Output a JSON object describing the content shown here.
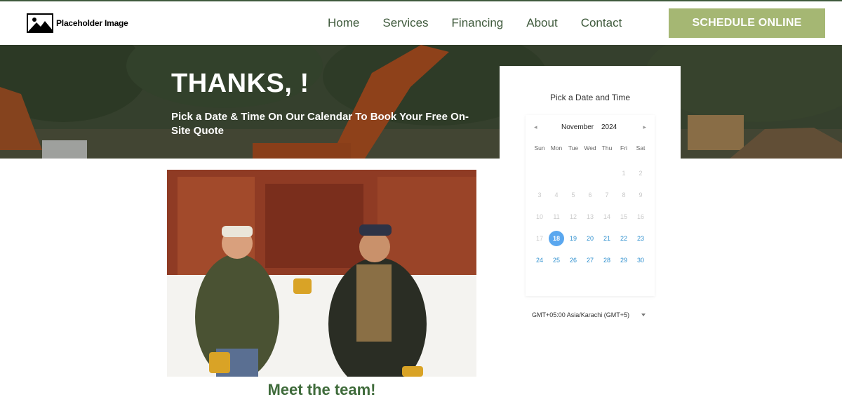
{
  "header": {
    "logo_text": "Placeholder Image",
    "nav": [
      "Home",
      "Services",
      "Financing",
      "About",
      "Contact"
    ],
    "cta_label": "SCHEDULE ONLINE"
  },
  "hero": {
    "title": "THANKS, !",
    "subtitle": "Pick a Date & Time On Our Calendar To Book Your Free On-Site Quote"
  },
  "booking": {
    "title": "Pick a Date and Time",
    "calendar": {
      "month": "November",
      "year": "2024",
      "weekdays": [
        "Sun",
        "Mon",
        "Tue",
        "Wed",
        "Thu",
        "Fri",
        "Sat"
      ],
      "prev_icon": "chevron-left-icon",
      "next_icon": "chevron-right-icon",
      "first_weekday_index": 5,
      "days_in_month": 30,
      "selected_day": 18,
      "first_available_day": 18
    },
    "timezone": "GMT+05:00 Asia/Karachi (GMT+5)"
  },
  "team": {
    "title": "Meet the team!"
  },
  "colors": {
    "brand_green": "#3f5a3c",
    "cta_green": "#a5b773",
    "team_title": "#3f6b3b",
    "available_day": "#2d8fcf",
    "selected_day": "#5aa7ef",
    "disabled_day": "#c9c9c9"
  }
}
